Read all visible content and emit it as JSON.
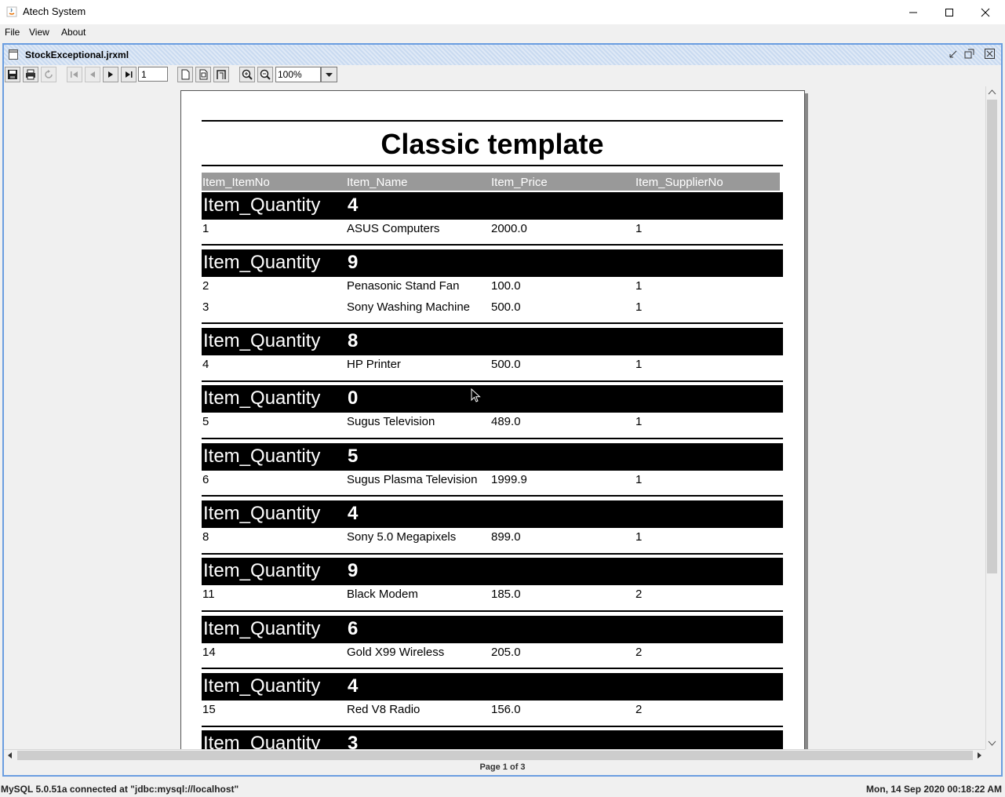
{
  "window": {
    "title": "Atech System"
  },
  "menu": [
    "File",
    "View",
    "About"
  ],
  "frame": {
    "title": "StockExceptional.jrxml"
  },
  "toolbar": {
    "page_value": "1",
    "zoom_value": "100%"
  },
  "report": {
    "title": "Classic template",
    "columns": [
      "Item_ItemNo",
      "Item_Name",
      "Item_Price",
      "Item_SupplierNo"
    ],
    "group_label": "Item_Quantity",
    "groups": [
      {
        "quantity": "4",
        "rows": [
          [
            "1",
            "ASUS Computers",
            "2000.0",
            "1"
          ]
        ]
      },
      {
        "quantity": "9",
        "rows": [
          [
            "2",
            "Penasonic Stand Fan",
            "100.0",
            "1"
          ],
          [
            "3",
            "Sony Washing Machine",
            "500.0",
            "1"
          ]
        ]
      },
      {
        "quantity": "8",
        "rows": [
          [
            "4",
            "HP Printer",
            "500.0",
            "1"
          ]
        ]
      },
      {
        "quantity": "0",
        "rows": [
          [
            "5",
            "Sugus Television",
            "489.0",
            "1"
          ]
        ]
      },
      {
        "quantity": "5",
        "rows": [
          [
            "6",
            "Sugus Plasma Television",
            "1999.9",
            "1"
          ]
        ]
      },
      {
        "quantity": "4",
        "rows": [
          [
            "8",
            "Sony 5.0 Megapixels",
            "899.0",
            "1"
          ]
        ]
      },
      {
        "quantity": "9",
        "rows": [
          [
            "11",
            "Black Modem",
            "185.0",
            "2"
          ]
        ]
      },
      {
        "quantity": "6",
        "rows": [
          [
            "14",
            "Gold X99 Wireless",
            "205.0",
            "2"
          ]
        ]
      },
      {
        "quantity": "4",
        "rows": [
          [
            "15",
            "Red V8 Radio",
            "156.0",
            "2"
          ]
        ]
      },
      {
        "quantity": "3",
        "rows": []
      }
    ]
  },
  "pager": {
    "status": "Page 1 of 3"
  },
  "status": {
    "db": "MySQL 5.0.51a connected at \"jdbc:mysql://localhost\"",
    "clock": "Mon, 14 Sep 2020 00:18:22 AM"
  }
}
